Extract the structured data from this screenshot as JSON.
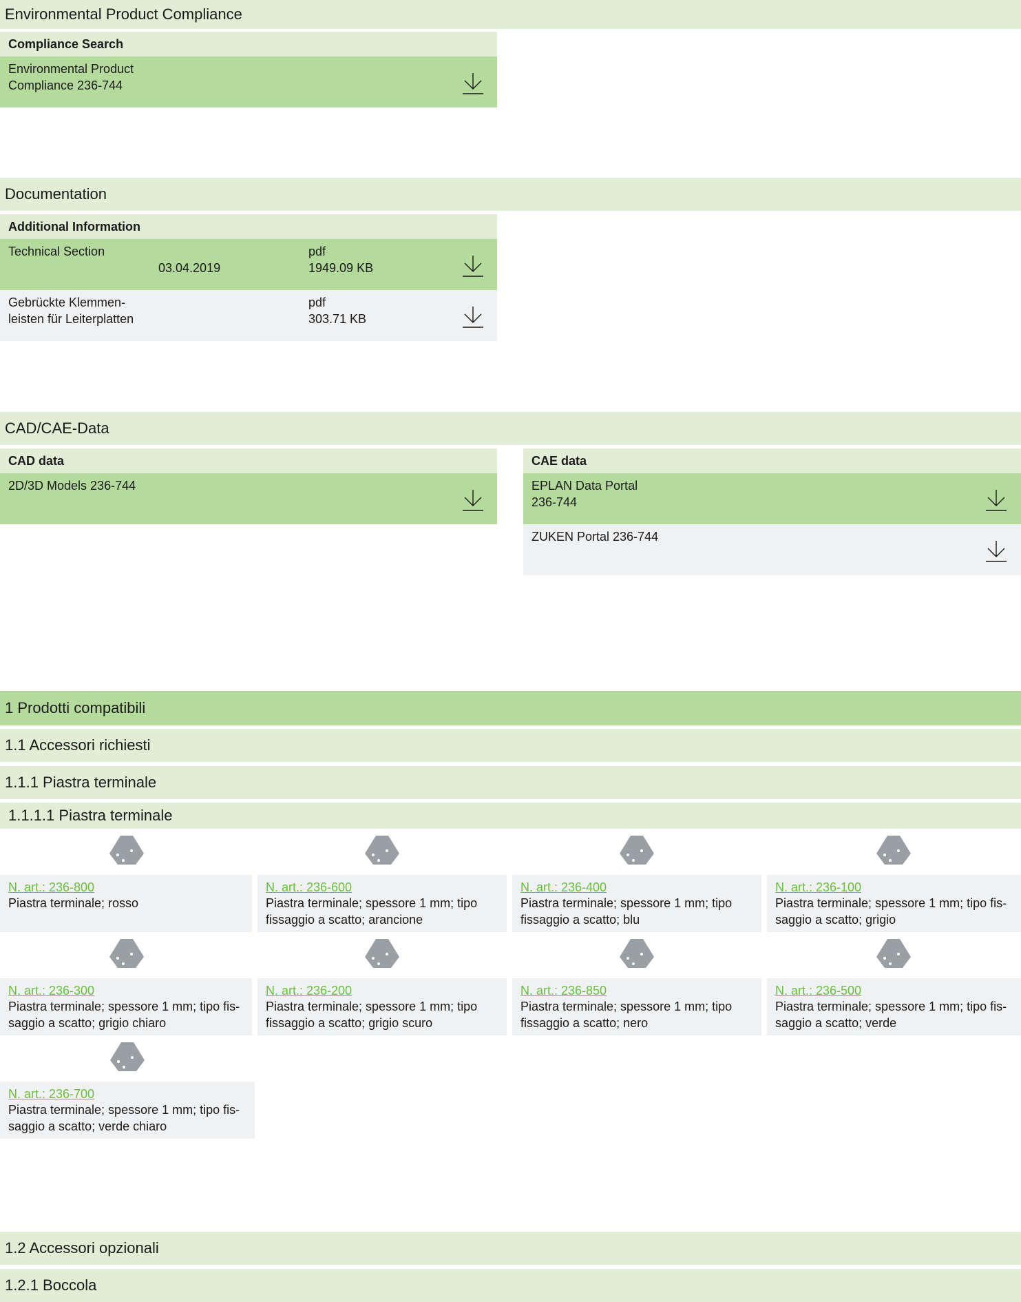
{
  "env": {
    "section_title": "Environmental Product Compliance",
    "sub_title": "Compliance Search",
    "row_label": "Environmental Product\nCompliance 236-744"
  },
  "docs": {
    "section_title": "Documentation",
    "sub_title": "Additional Information",
    "rows": [
      {
        "name": "Technical Section",
        "date": "03.04.2019",
        "type": "pdf",
        "size": "1949.09 KB"
      },
      {
        "name": "Gebrückte Klemmen-\nleisten für Leiterplatten",
        "date": "",
        "type": "pdf",
        "size": "303.71 KB"
      }
    ]
  },
  "cad": {
    "section_title": "CAD/CAE-Data",
    "cad_title": "CAD data",
    "cad_row": "2D/3D Models 236-744",
    "cae_title": "CAE data",
    "cae_rows": [
      "EPLAN Data Portal\n236-744",
      "ZUKEN Portal 236-744"
    ]
  },
  "products": {
    "h1": "1 Prodotti compatibili",
    "h2": "1.1 Accessori richiesti",
    "h3": "1.1.1 Piastra terminale",
    "h4": "1.1.1.1 Piastra terminale",
    "items": [
      {
        "link": "N. art.: 236-800",
        "desc": "Piastra terminale; rosso"
      },
      {
        "link": "N. art.: 236-600",
        "desc": "Piastra terminale; spessore 1 mm; tipo\nfissaggio a scatto; arancione"
      },
      {
        "link": "N. art.: 236-400",
        "desc": "Piastra terminale; spessore 1 mm; tipo\nfissaggio a scatto; blu"
      },
      {
        "link": "N. art.: 236-100",
        "desc": "Piastra terminale; spessore 1 mm; tipo fis-\nsaggio a scatto; grigio"
      },
      {
        "link": "N. art.: 236-300",
        "desc": "Piastra terminale; spessore 1 mm; tipo fis-\nsaggio a scatto; grigio chiaro"
      },
      {
        "link": "N. art.: 236-200",
        "desc": "Piastra terminale; spessore 1 mm; tipo\nfissaggio a scatto; grigio scuro"
      },
      {
        "link": "N. art.: 236-850",
        "desc": "Piastra terminale; spessore 1 mm; tipo\nfissaggio a scatto; nero"
      },
      {
        "link": "N. art.: 236-500",
        "desc": "Piastra terminale; spessore 1 mm; tipo fis-\nsaggio a scatto; verde"
      },
      {
        "link": "N. art.: 236-700",
        "desc": "Piastra terminale; spessore 1 mm; tipo fis-\nsaggio a scatto; verde chiaro"
      }
    ],
    "h5": "1.2 Accessori opzionali",
    "h6": "1.2.1 Boccola"
  },
  "colors": {
    "band_light": "#e1edd5",
    "band_mid": "#b5db9c",
    "row_grey": "#f0f1f2",
    "link_green": "#6abf3e"
  },
  "icons": {
    "download": "download-icon",
    "product": "end-plate-icon"
  }
}
